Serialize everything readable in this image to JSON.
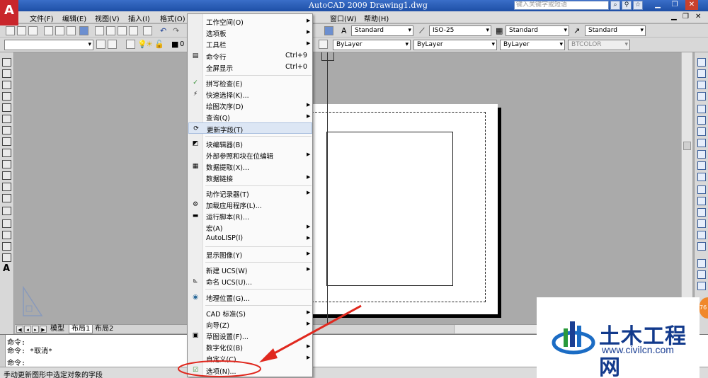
{
  "window": {
    "title": "AutoCAD 2009 Drawing1.dwg",
    "search_placeholder": "键入关键字或短语",
    "logo_letter": "A"
  },
  "menubar": {
    "items": [
      "文件(F)",
      "编辑(E)",
      "视图(V)",
      "插入(I)",
      "格式(O)",
      "窗口(W)",
      "帮助(H)"
    ]
  },
  "toolbar": {
    "text_style": "Standard",
    "dim_style": "ISO-25",
    "table_style": "Standard",
    "multileader_style": "Standard",
    "layer_name": "0",
    "color": "ByLayer",
    "linetype": "ByLayer",
    "lineweight": "ByLayer",
    "plot_style": "BTCOLOR"
  },
  "tools_menu": {
    "items": [
      {
        "label": "工作空间(O)",
        "submenu": true
      },
      {
        "label": "选项板",
        "submenu": true
      },
      {
        "label": "工具栏",
        "submenu": true
      },
      {
        "label": "命令行",
        "shortcut": "Ctrl+9"
      },
      {
        "label": "全屏显示",
        "shortcut": "Ctrl+0"
      },
      {
        "label": "拼写检查(E)"
      },
      {
        "label": "快速选择(K)..."
      },
      {
        "label": "绘图次序(D)",
        "submenu": true
      },
      {
        "label": "查询(Q)",
        "submenu": true
      },
      {
        "label": "更新字段(T)",
        "highlighted": true
      },
      {
        "label": "块编辑器(B)"
      },
      {
        "label": "外部参照和块在位编辑",
        "submenu": true
      },
      {
        "label": "数据提取(X)..."
      },
      {
        "label": "数据链接",
        "submenu": true
      },
      {
        "label": "动作记录器(T)",
        "submenu": true
      },
      {
        "label": "加载应用程序(L)..."
      },
      {
        "label": "运行脚本(R)..."
      },
      {
        "label": "宏(A)",
        "submenu": true
      },
      {
        "label": "AutoLISP(I)",
        "submenu": true
      },
      {
        "label": "显示图像(Y)",
        "submenu": true
      },
      {
        "label": "新建 UCS(W)",
        "submenu": true
      },
      {
        "label": "命名 UCS(U)..."
      },
      {
        "label": "地理位置(G)..."
      },
      {
        "label": "CAD 标准(S)",
        "submenu": true
      },
      {
        "label": "向导(Z)",
        "submenu": true
      },
      {
        "label": "草图设置(F)..."
      },
      {
        "label": "数字化仪(B)",
        "submenu": true
      },
      {
        "label": "自定义(C)",
        "submenu": true
      },
      {
        "label": "选项(N)..."
      }
    ]
  },
  "tabs": {
    "model": "模型",
    "layout1": "布局1",
    "layout2": "布局2"
  },
  "command": {
    "line1": "命令:",
    "line2": "命令: *取消*",
    "line3": "命令:"
  },
  "status": {
    "text": "手动更新图形中选定对象的字段"
  },
  "watermark": {
    "brand": "土木工程网",
    "url": "www.civilcn.com",
    "badge": "76"
  },
  "colors": {
    "accent_red": "#e0281e",
    "title_blue": "#1e4fa6"
  }
}
